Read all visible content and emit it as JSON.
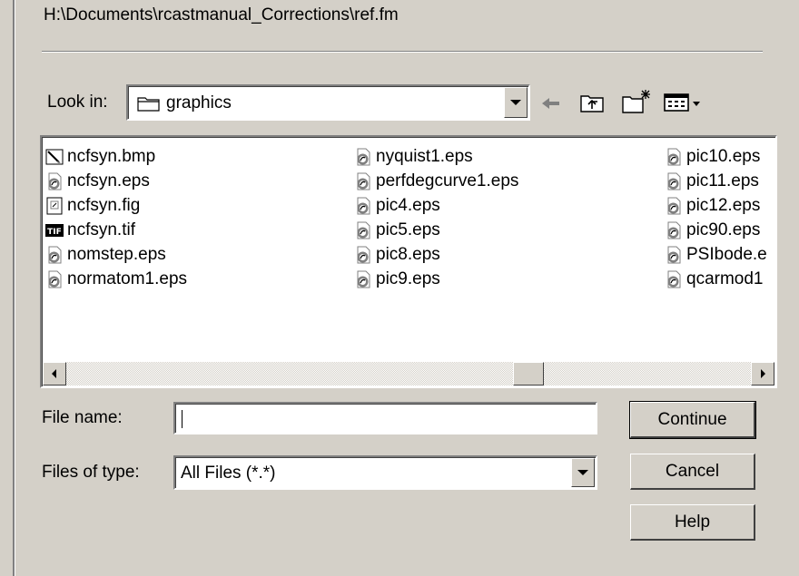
{
  "dialog": {
    "path": "H:\\Documents\\rcastmanual_Corrections\\ref.fm",
    "look_in_label": "Look in:",
    "look_in_value": "graphics",
    "toolbar_icons": [
      "back-arrow-icon",
      "up-folder-icon",
      "new-folder-icon",
      "view-menu-icon"
    ]
  },
  "files": [
    {
      "name": "ncfsyn.bmp",
      "icon": "bmp-file-icon"
    },
    {
      "name": "ncfsyn.eps",
      "icon": "eps-file-icon"
    },
    {
      "name": "ncfsyn.fig",
      "icon": "fig-file-icon"
    },
    {
      "name": "ncfsyn.tif",
      "icon": "tif-file-icon"
    },
    {
      "name": "nomstep.eps",
      "icon": "eps-file-icon"
    },
    {
      "name": "normatom1.eps",
      "icon": "eps-file-icon"
    },
    {
      "name": "nyquist1.eps",
      "icon": "eps-file-icon"
    },
    {
      "name": "perfdegcurve1.eps",
      "icon": "eps-file-icon"
    },
    {
      "name": "pic4.eps",
      "icon": "eps-file-icon"
    },
    {
      "name": "pic5.eps",
      "icon": "eps-file-icon"
    },
    {
      "name": "pic8.eps",
      "icon": "eps-file-icon"
    },
    {
      "name": "pic9.eps",
      "icon": "eps-file-icon"
    },
    {
      "name": "pic10.eps",
      "icon": "eps-file-icon"
    },
    {
      "name": "pic11.eps",
      "icon": "eps-file-icon"
    },
    {
      "name": "pic12.eps",
      "icon": "eps-file-icon"
    },
    {
      "name": "pic90.eps",
      "icon": "eps-file-icon"
    },
    {
      "name": "PSIbode.e",
      "icon": "eps-file-icon"
    },
    {
      "name": "qcarmod1",
      "icon": "eps-file-icon"
    }
  ],
  "form": {
    "file_name_label": "File name:",
    "file_name_value": "",
    "file_type_label": "Files of type:",
    "file_type_value": "All Files (*.*)"
  },
  "buttons": {
    "continue": "Continue",
    "cancel": "Cancel",
    "help": "Help"
  }
}
